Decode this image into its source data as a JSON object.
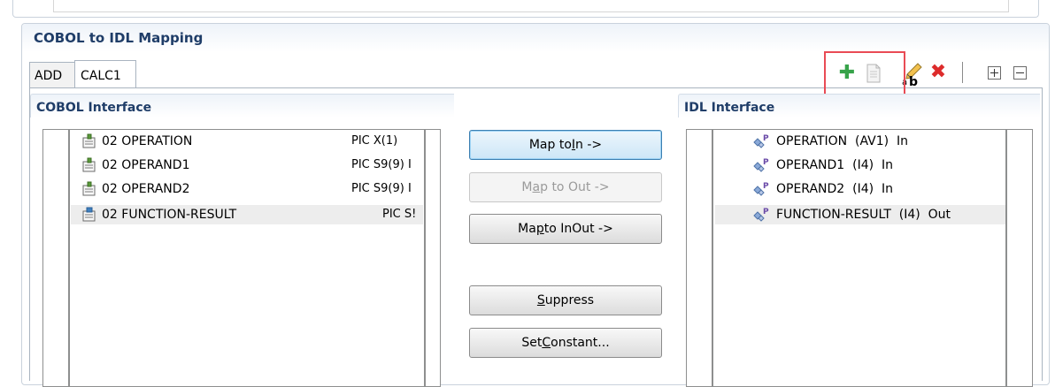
{
  "section": {
    "title": "COBOL to IDL Mapping"
  },
  "tabs": [
    {
      "label": "ADD",
      "active": false
    },
    {
      "label": "CALC1",
      "active": true
    }
  ],
  "toolbar": {
    "icons": [
      "add-icon",
      "copy-icon",
      "rename-icon",
      "delete-icon",
      "expand-all-icon",
      "collapse-all-icon"
    ],
    "highlight_color": "#e94b55"
  },
  "cobol": {
    "title": "COBOL Interface",
    "rows": [
      {
        "name": "02 OPERATION",
        "pic": "PIC X(1)",
        "selected": false
      },
      {
        "name": "02 OPERAND1",
        "pic": "PIC S9(9) I",
        "selected": false
      },
      {
        "name": "02 OPERAND2",
        "pic": "PIC S9(9) I",
        "selected": false
      },
      {
        "name": "02 FUNCTION-RESULT",
        "pic": "PIC S!",
        "selected": true
      }
    ]
  },
  "buttons": {
    "map_in": {
      "pre": "Map to ",
      "key": "I",
      "post": "n ->"
    },
    "map_out": {
      "pre": "M",
      "key": "a",
      "post": "p to Out ->"
    },
    "map_inout": {
      "pre": "Ma",
      "key": "p",
      "post": " to InOut ->"
    },
    "suppress": {
      "pre": "",
      "key": "S",
      "post": "uppress"
    },
    "set_constant": {
      "pre": "Set ",
      "key": "C",
      "post": "onstant..."
    }
  },
  "idl": {
    "title": "IDL Interface",
    "rows": [
      {
        "label": "OPERATION  (AV1)  In",
        "selected": false
      },
      {
        "label": "OPERAND1  (I4)  In",
        "selected": false
      },
      {
        "label": "OPERAND2  (I4)  In",
        "selected": false
      },
      {
        "label": "FUNCTION-RESULT  (I4)  Out",
        "selected": true
      }
    ]
  }
}
